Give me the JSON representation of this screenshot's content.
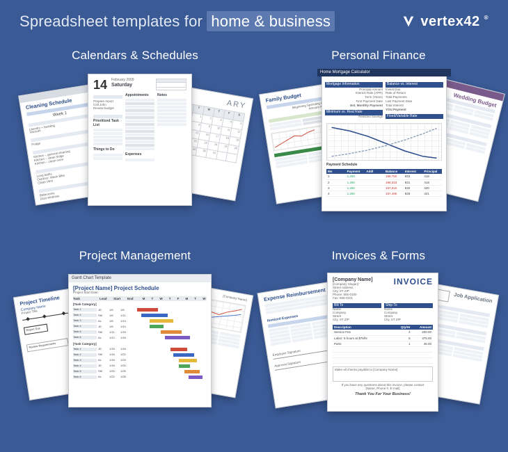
{
  "headline_prefix": "Spreadsheet templates for",
  "headline_highlight": "home & business",
  "brand_name": "vertex42",
  "categories": {
    "calendars": {
      "title": "Calendars & Schedules",
      "templates": {
        "cleaning": {
          "title": "Cleaning Schedule",
          "week_label": "Week 1"
        },
        "daily": {
          "big_day": "14",
          "date_text": "February 2009",
          "weekday": "Saturday",
          "col1": "Prioritized Task List",
          "col2": "Appointments",
          "col3": "Notes",
          "footer1": "Things to Do",
          "footer2": "Expenses"
        },
        "monthly": {
          "month_suffix": "ARY",
          "days": [
            "S",
            "M",
            "T",
            "W",
            "T",
            "F",
            "S"
          ]
        }
      }
    },
    "finance": {
      "title": "Personal Finance",
      "templates": {
        "family_budget": {
          "title": "Family Budget"
        },
        "mortgage": {
          "title": "Home Mortgage Calculator",
          "box1": "Mortgage Information",
          "box2": "Balance vs. Interest",
          "footer_title": "Payment Schedule"
        },
        "wedding": {
          "title": "Wedding Budget"
        }
      }
    },
    "project": {
      "title": "Project Management",
      "templates": {
        "timeline": {
          "title": "Project Timeline",
          "sub": "Company Name",
          "sub2": "Project Title"
        },
        "gantt": {
          "title_bar": "Gantt Chart Template",
          "project": "[Project Name] Project Schedule",
          "startlbl": "Project Start Date:",
          "cols": [
            "Task",
            "Lead",
            "Start",
            "End"
          ]
        },
        "other": {
          "corner": "[Company Name]"
        }
      }
    },
    "invoices": {
      "title": "Invoices & Forms",
      "templates": {
        "expense": {
          "title": "Expense Reimbursement",
          "section": "Itemized Expenses",
          "sig1": "Employee Signature",
          "sig2": "Approval Signature"
        },
        "invoice": {
          "company": "[Company Name]",
          "slogan": "[Company Slogan]",
          "heading": "INVOICE",
          "col1": "Description",
          "col2": "Qty/Hr",
          "col3": "Amount",
          "thanks": "Thank You For Your Business!"
        },
        "jobapp": {
          "title": "Job Application"
        }
      }
    }
  }
}
